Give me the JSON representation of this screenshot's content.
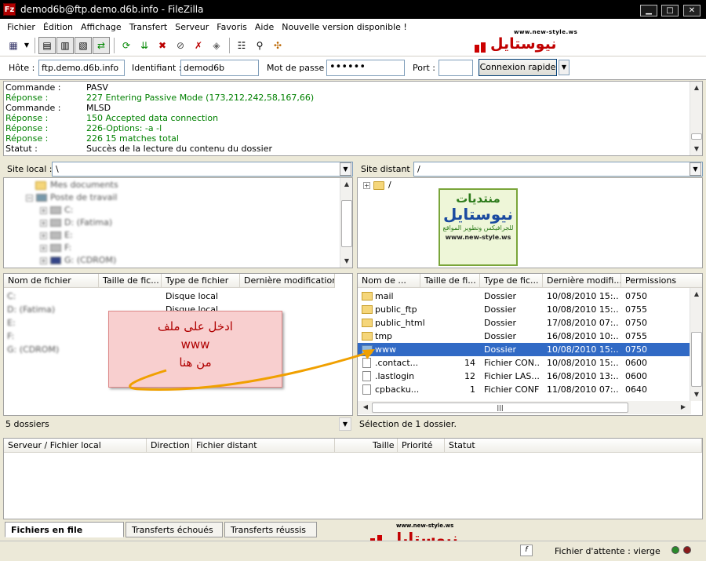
{
  "window": {
    "title": "demod6b@ftp.demo.d6b.info - FileZilla",
    "icon_letters": "Fz"
  },
  "menu": [
    "Fichier",
    "Édition",
    "Affichage",
    "Transfert",
    "Serveur",
    "Favoris",
    "Aide",
    "Nouvelle version disponible !"
  ],
  "quickconnect": {
    "host_label": "Hôte :",
    "host_value": "ftp.demo.d6b.info",
    "user_label": "Identifiant :",
    "user_value": "demod6b",
    "pass_label": "Mot de passe :",
    "pass_value": "••••••",
    "port_label": "Port :",
    "port_value": "",
    "connect_label": "Connexion rapide"
  },
  "log": [
    {
      "label": "Commande :",
      "text": "PASV",
      "color": "black"
    },
    {
      "label": "Réponse :",
      "text": "227 Entering Passive Mode (173,212,242,58,167,66)",
      "color": "green"
    },
    {
      "label": "Commande :",
      "text": "MLSD",
      "color": "black"
    },
    {
      "label": "Réponse :",
      "text": "150 Accepted data connection",
      "color": "green"
    },
    {
      "label": "Réponse :",
      "text": "226-Options: -a -l",
      "color": "green"
    },
    {
      "label": "Réponse :",
      "text": "226 15 matches total",
      "color": "green"
    },
    {
      "label": "Statut :",
      "text": "Succès de la lecture du contenu du dossier",
      "color": "black"
    }
  ],
  "local": {
    "site_label": "Site local :",
    "path": "\\",
    "tree": [
      "Mes documents",
      "Poste de travail",
      "C:",
      "D: (Fatima)",
      "E:",
      "F:",
      "G: (CDROM)"
    ],
    "headers": [
      "Nom de fichier",
      "Taille de fic...",
      "Type de fichier",
      "Dernière modification"
    ],
    "files": [
      {
        "name": "C:",
        "size": "",
        "type": "Disque local"
      },
      {
        "name": "D: (Fatima)",
        "size": "",
        "type": "Disque local"
      },
      {
        "name": "E:",
        "size": "",
        "type": "Disque local"
      },
      {
        "name": "F:",
        "size": "",
        "type": ""
      },
      {
        "name": "G: (CDROM)",
        "size": "",
        "type": ""
      }
    ],
    "status": "5 dossiers"
  },
  "remote": {
    "site_label": "Site distant :",
    "path": "/",
    "tree_root": "/",
    "headers": [
      "Nom de ...",
      "Taille de fi...",
      "Type de fic...",
      "Dernière modifi...",
      "Permissions"
    ],
    "files": [
      {
        "name": "mail",
        "size": "",
        "type": "Dossier",
        "date": "10/08/2010 15:...",
        "perm": "0750",
        "kind": "folder"
      },
      {
        "name": "public_ftp",
        "size": "",
        "type": "Dossier",
        "date": "10/08/2010 15:...",
        "perm": "0755",
        "kind": "folder"
      },
      {
        "name": "public_html",
        "size": "",
        "type": "Dossier",
        "date": "17/08/2010 07:...",
        "perm": "0750",
        "kind": "folder"
      },
      {
        "name": "tmp",
        "size": "",
        "type": "Dossier",
        "date": "16/08/2010 10:...",
        "perm": "0755",
        "kind": "folder"
      },
      {
        "name": "www",
        "size": "",
        "type": "Dossier",
        "date": "10/08/2010 15:...",
        "perm": "0750",
        "kind": "folder-link",
        "selected": true
      },
      {
        "name": ".contact...",
        "size": "14",
        "type": "Fichier CON...",
        "date": "10/08/2010 15:...",
        "perm": "0600",
        "kind": "file"
      },
      {
        "name": ".lastlogin",
        "size": "12",
        "type": "Fichier LAS...",
        "date": "16/08/2010 13:...",
        "perm": "0600",
        "kind": "file"
      },
      {
        "name": "cpbacku...",
        "size": "1",
        "type": "Fichier CONF",
        "date": "11/08/2010 07:...",
        "perm": "0640",
        "kind": "file"
      }
    ],
    "status": "Sélection de 1 dossier."
  },
  "annotation": {
    "line1": "ادخل على ملف",
    "line2": "www",
    "line3": "من هنا"
  },
  "watermark": {
    "site": "www.new-style.ws",
    "brand": "نيوستايل",
    "forum": "منتديات",
    "tagline": "للجرافيكس وتطوير المواقع"
  },
  "queue": {
    "headers": [
      "Serveur / Fichier local",
      "Direction",
      "Fichier distant",
      "Taille",
      "Priorité",
      "Statut"
    ],
    "tabs": [
      "Fichiers en file d'attente",
      "Transferts échoués",
      "Transferts réussis"
    ],
    "status": "Fichier d'attente : vierge"
  },
  "colors": {
    "selection": "#316ac5",
    "log_green": "#008000",
    "annotation_red": "#b00000",
    "arrow": "#f0a000"
  }
}
